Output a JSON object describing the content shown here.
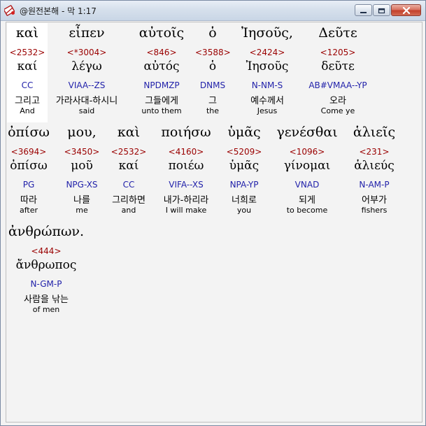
{
  "window": {
    "title": "@원전본해 - 막 1:17"
  },
  "words": [
    {
      "greek": "καὶ",
      "strong": "<2532>",
      "lemma": "καί",
      "morph": "CC",
      "korean": "그리고",
      "english": "And"
    },
    {
      "greek": "εἶπεν",
      "strong": "<*3004>",
      "lemma": "λέγω",
      "morph": "VIAA--ZS",
      "korean": "가라사대-하시니",
      "english": "said"
    },
    {
      "greek": "αὐτοῖς",
      "strong": "<846>",
      "lemma": "αὐτός",
      "morph": "NPDMZP",
      "korean": "그들에게",
      "english": "unto them"
    },
    {
      "greek": "ὁ",
      "strong": "<3588>",
      "lemma": "ὁ",
      "morph": "DNMS",
      "korean": "그",
      "english": "the"
    },
    {
      "greek": "Ἰησοῦς,",
      "strong": "<2424>",
      "lemma": "Ἰησοῦς",
      "morph": "N-NM-S",
      "korean": "예수께서",
      "english": "Jesus"
    },
    {
      "greek": "Δεῦτε",
      "strong": "<1205>",
      "lemma": "δεῦτε",
      "morph": "AB#VMAA--YP",
      "korean": "오라",
      "english": "Come ye"
    },
    {
      "greek": "ὀπίσω",
      "strong": "<3694>",
      "lemma": "ὀπίσω",
      "morph": "PG",
      "korean": "따라",
      "english": "after"
    },
    {
      "greek": "μου,",
      "strong": "<3450>",
      "lemma": "μοῦ",
      "morph": "NPG-XS",
      "korean": "나를",
      "english": "me"
    },
    {
      "greek": "καὶ",
      "strong": "<2532>",
      "lemma": "καί",
      "morph": "CC",
      "korean": "그리하면",
      "english": "and"
    },
    {
      "greek": "ποιήσω",
      "strong": "<4160>",
      "lemma": "ποιέω",
      "morph": "VIFA--XS",
      "korean": "내가-하리라",
      "english": "I will make"
    },
    {
      "greek": "ὑμᾶς",
      "strong": "<5209>",
      "lemma": "ὑμᾶς",
      "morph": "NPA-YP",
      "korean": "너희로",
      "english": "you"
    },
    {
      "greek": "γενέσθαι",
      "strong": "<1096>",
      "lemma": "γίνομαι",
      "morph": "VNAD",
      "korean": "되게",
      "english": "to become"
    },
    {
      "greek": "ἁλιεῖς",
      "strong": "<231>",
      "lemma": "ἁλιεύς",
      "morph": "N-AM-P",
      "korean": "어부가",
      "english": "fishers"
    },
    {
      "greek": "ἀνθρώπων.",
      "strong": "<444>",
      "lemma": "ἄνθρωπος",
      "morph": "N-GM-P",
      "korean": "사람을 낚는",
      "english": "of men"
    }
  ]
}
